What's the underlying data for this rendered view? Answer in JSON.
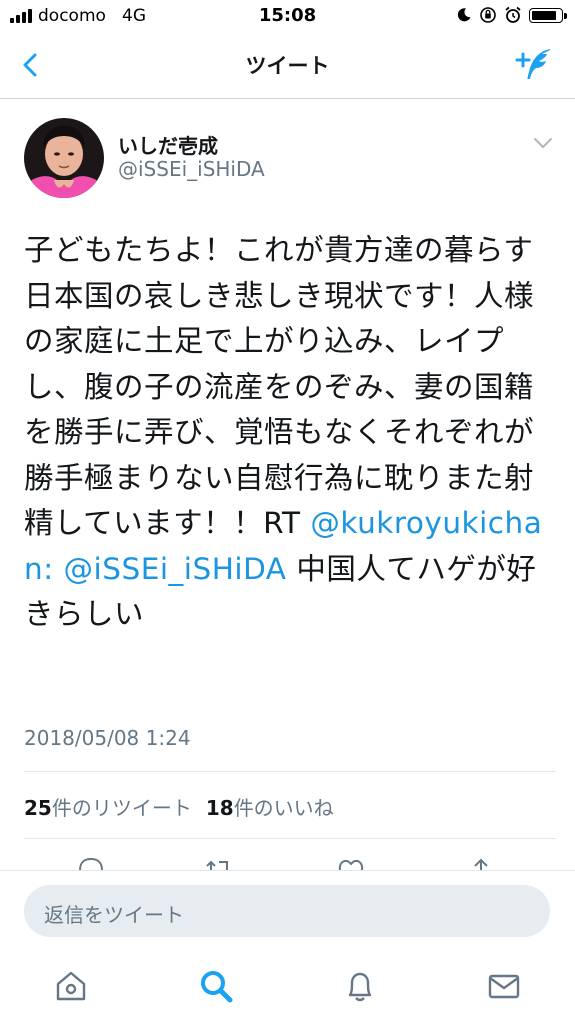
{
  "status_bar": {
    "carrier": "docomo",
    "network": "4G",
    "time": "15:08",
    "battery_level": 0.9
  },
  "nav": {
    "title": "ツイート",
    "back_icon": "chevron-left-icon",
    "compose_icon": "compose-tweet-icon"
  },
  "colors": {
    "accent": "#1da1f2",
    "link": "#1b95e0",
    "secondary_text": "#657786",
    "reply_bg": "#e6ecf0"
  },
  "tweet": {
    "display_name": "いしだ壱成",
    "handle": "@iSSEi_iSHiDA",
    "text_main": "子どもたちよ！これが貴方達の暮らす日本国の哀しき悲しき現状です！人様の家庭に土足で上がり込み、レイプし、腹の子の流産をのぞみ、妻の国籍を勝手に弄び、覚悟もなくそれぞれが勝手極まりない自慰行為に耽りまた射精しています！！RT",
    "mention_1": "@kukroyukichan",
    "colon": ":",
    "mention_2": "@iSSEi_iSHiDA",
    "text_tail": "中国人てハゲが好きらしい",
    "timestamp": "2018/05/08 1:24",
    "retweet_count": "25",
    "retweet_label": "件のリツイート",
    "like_count": "18",
    "like_label": "件のいいね"
  },
  "reply": {
    "placeholder": "返信をツイート"
  },
  "tab_bar": {
    "items": [
      "home-icon",
      "search-icon",
      "notifications-icon",
      "messages-icon"
    ]
  }
}
